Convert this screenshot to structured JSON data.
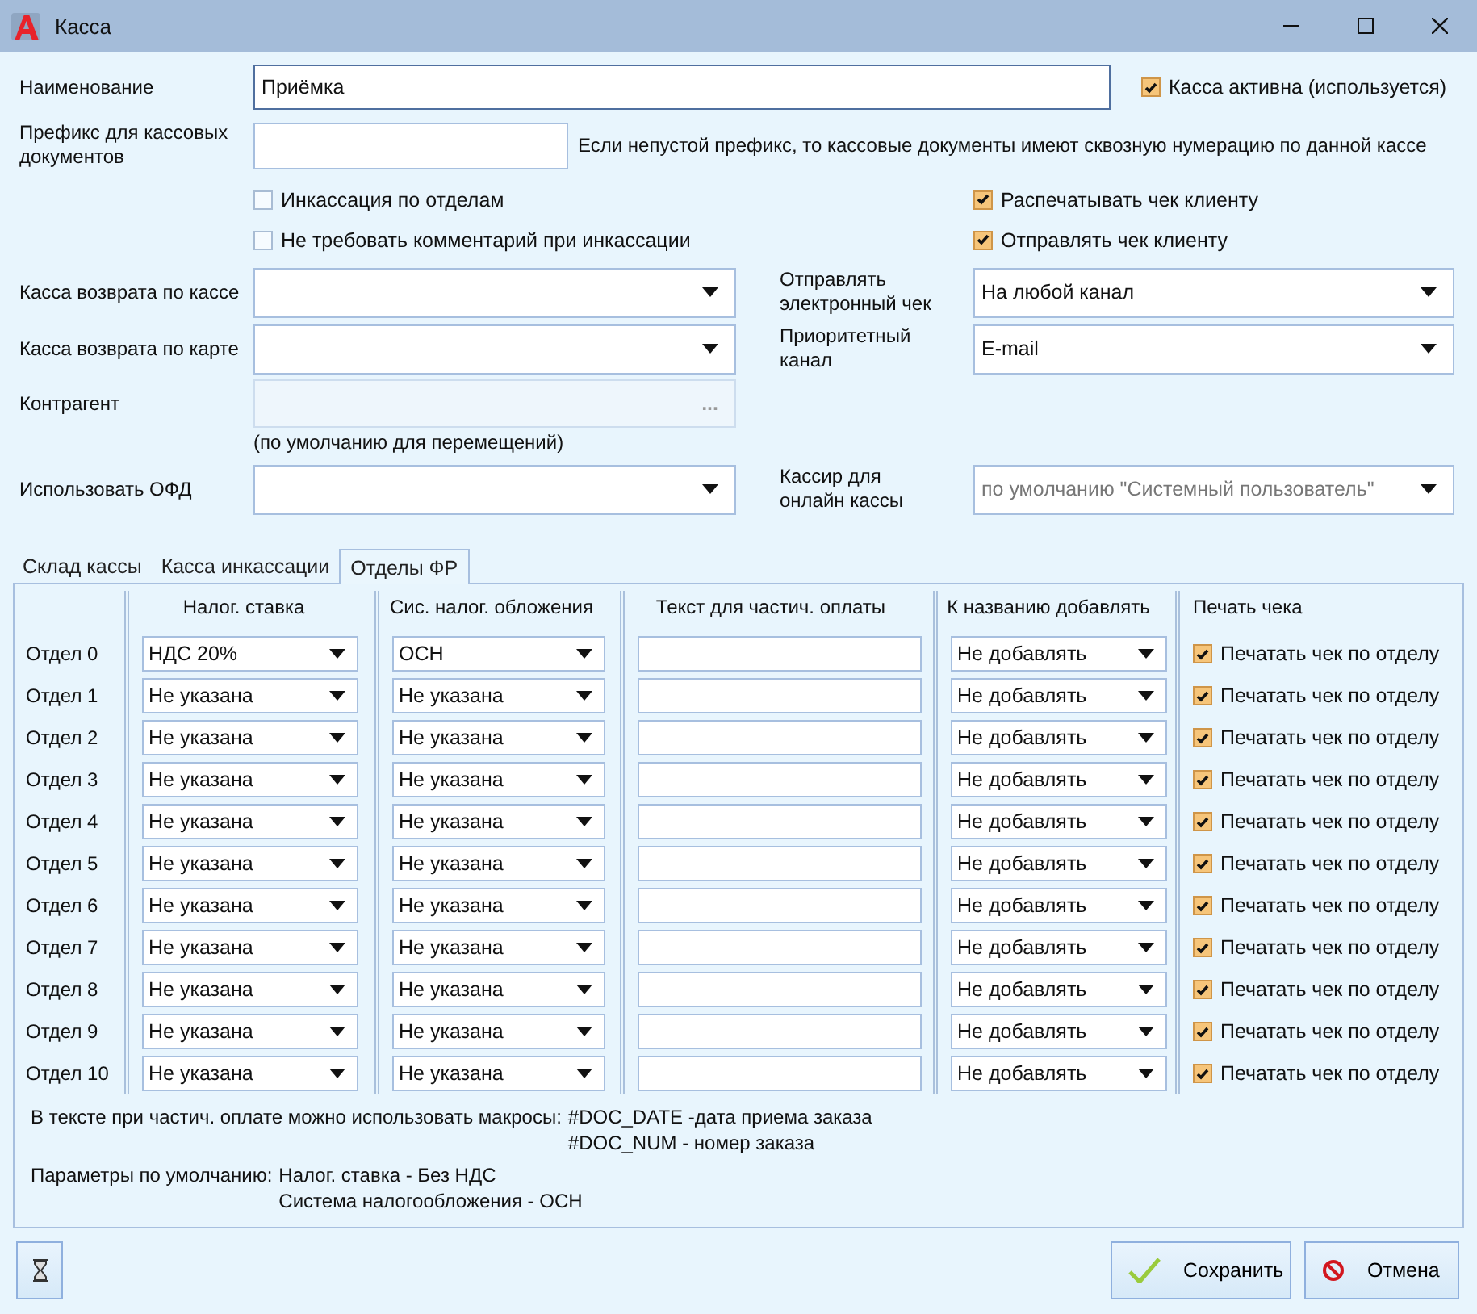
{
  "window": {
    "title": "Касса"
  },
  "name_field": {
    "label": "Наименование",
    "value": "Приёмка"
  },
  "active_checkbox": {
    "label": "Касса активна (используется)",
    "checked": true
  },
  "prefix_field": {
    "label": "Префикс для кассовых документов",
    "hint": "Если непустой префикс, то кассовые документы имеют сквозную нумерацию по данной кассе"
  },
  "left_checkboxes": [
    {
      "label": "Инкассация по отделам",
      "checked": false
    },
    {
      "label": "Не требовать комментарий при инкассации",
      "checked": false
    }
  ],
  "right_checkboxes": [
    {
      "label": "Распечатывать чек клиенту",
      "checked": true
    },
    {
      "label": "Отправлять чек клиенту",
      "checked": true
    }
  ],
  "return_cash": {
    "label": "Касса возврата по кассе"
  },
  "return_card": {
    "label": "Касса возврата по карте"
  },
  "send_receipt": {
    "label": "Отправлять электронный чек",
    "value": "На любой канал"
  },
  "priority_channel": {
    "label": "Приоритетный канал",
    "value": "E-mail"
  },
  "counterparty": {
    "label": "Контрагент",
    "button": "...",
    "hint": "(по умолчанию для перемещений)",
    "disabled": true
  },
  "ofd": {
    "label": "Использовать ОФД"
  },
  "cashier": {
    "label": "Кассир для онлайн кассы",
    "placeholder": "по умолчанию \"Системный пользователь\""
  },
  "tabs": [
    {
      "label": "Склад кассы",
      "selected": false
    },
    {
      "label": "Касса инкассации",
      "selected": false
    },
    {
      "label": "Отделы ФР",
      "selected": true
    }
  ],
  "columns": [
    "Налог. ставка",
    "Сис. налог. обложения",
    "Текст для частич. оплаты",
    "К названию добавлять",
    "Печать чека"
  ],
  "rows": [
    {
      "name": "Отдел 0",
      "tax_rate": "НДС 20%",
      "tax_system": "ОСН",
      "suffix": "Не добавлять",
      "print_label": "Печатать чек по отделу",
      "print_checked": true
    },
    {
      "name": "Отдел 1",
      "tax_rate": "Не указана",
      "tax_system": "Не указана",
      "suffix": "Не добавлять",
      "print_label": "Печатать чек по отделу",
      "print_checked": true
    },
    {
      "name": "Отдел 2",
      "tax_rate": "Не указана",
      "tax_system": "Не указана",
      "suffix": "Не добавлять",
      "print_label": "Печатать чек по отделу",
      "print_checked": true
    },
    {
      "name": "Отдел 3",
      "tax_rate": "Не указана",
      "tax_system": "Не указана",
      "suffix": "Не добавлять",
      "print_label": "Печатать чек по отделу",
      "print_checked": true
    },
    {
      "name": "Отдел 4",
      "tax_rate": "Не указана",
      "tax_system": "Не указана",
      "suffix": "Не добавлять",
      "print_label": "Печатать чек по отделу",
      "print_checked": true
    },
    {
      "name": "Отдел 5",
      "tax_rate": "Не указана",
      "tax_system": "Не указана",
      "suffix": "Не добавлять",
      "print_label": "Печатать чек по отделу",
      "print_checked": true
    },
    {
      "name": "Отдел 6",
      "tax_rate": "Не указана",
      "tax_system": "Не указана",
      "suffix": "Не добавлять",
      "print_label": "Печатать чек по отделу",
      "print_checked": true
    },
    {
      "name": "Отдел 7",
      "tax_rate": "Не указана",
      "tax_system": "Не указана",
      "suffix": "Не добавлять",
      "print_label": "Печатать чек по отделу",
      "print_checked": true
    },
    {
      "name": "Отдел 8",
      "tax_rate": "Не указана",
      "tax_system": "Не указана",
      "suffix": "Не добавлять",
      "print_label": "Печатать чек по отделу",
      "print_checked": true
    },
    {
      "name": "Отдел 9",
      "tax_rate": "Не указана",
      "tax_system": "Не указана",
      "suffix": "Не добавлять",
      "print_label": "Печатать чек по отделу",
      "print_checked": true
    },
    {
      "name": "Отдел 10",
      "tax_rate": "Не указана",
      "tax_system": "Не указана",
      "suffix": "Не добавлять",
      "print_label": "Печатать чек по отделу",
      "print_checked": true
    }
  ],
  "notes": [
    {
      "label": "В тексте при частич. оплате можно использовать макросы:",
      "lines": [
        "#DOC_DATE -дата приема заказа",
        "#DOC_NUM - номер заказа"
      ]
    },
    {
      "label": "Параметры по умолчанию:",
      "lines": [
        "Налог. ставка - Без НДС",
        "Система налогообложения - ОСН"
      ]
    }
  ],
  "buttons": [
    {
      "kind": "save",
      "label": "Сохранить"
    },
    {
      "kind": "cancel",
      "label": "Отмена"
    }
  ]
}
